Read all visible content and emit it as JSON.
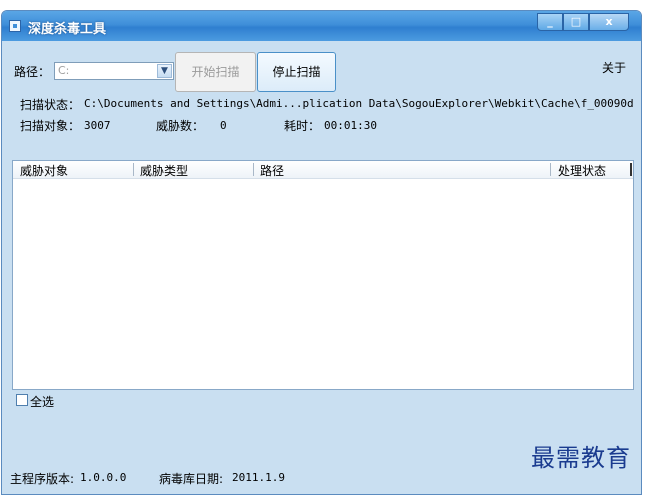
{
  "window": {
    "title": "深度杀毒工具",
    "controls": {
      "minimize": "_",
      "maximize": "□",
      "close": "x"
    }
  },
  "path": {
    "label": "路径：",
    "value": "C:"
  },
  "buttons": {
    "start_scan": "开始扫描",
    "stop_scan": "停止扫描"
  },
  "about_link": "关于",
  "status": {
    "label": "扫描状态：",
    "value": "C:\\Documents and Settings\\Admi...plication Data\\SogouExplorer\\Webkit\\Cache\\f_00090d",
    "objects_label": "扫描对象：",
    "objects_value": "3007",
    "threats_label": "威胁数：",
    "threats_value": "0",
    "elapsed_label": "耗时：",
    "elapsed_value": "00:01:30"
  },
  "list": {
    "columns": [
      "威胁对象",
      "威胁类型",
      "路径",
      "处理状态"
    ],
    "rows": []
  },
  "select_all": "全选",
  "footer": {
    "version_label": "主程序版本:",
    "version_value": "1.0.0.0",
    "db_date_label": "病毒库日期:",
    "db_date_value": "2011.1.9"
  },
  "watermark": "最需教育"
}
